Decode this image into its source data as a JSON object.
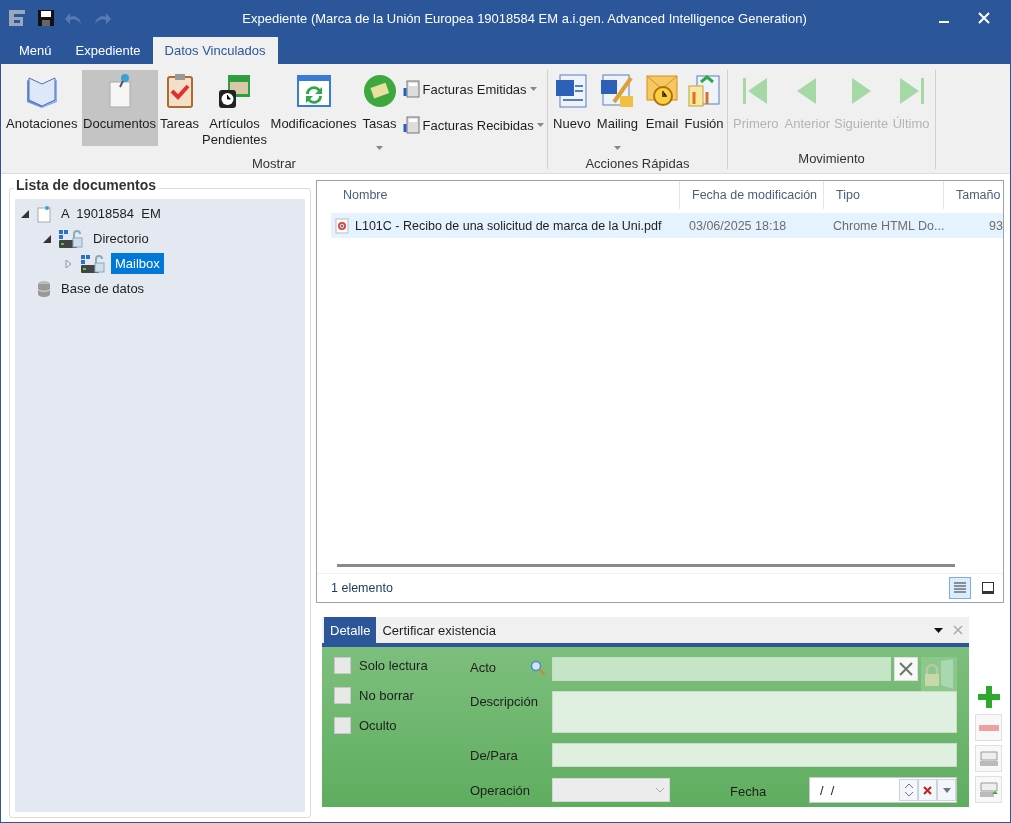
{
  "title_bar": {
    "title": "Expediente (Marca de la Unión Europea 19018584 EM a.i.gen. Advanced Intelligence Generation)"
  },
  "ribbon_tabs": [
    {
      "label": "Menú",
      "selected": false
    },
    {
      "label": "Expediente",
      "selected": false
    },
    {
      "label": "Datos Vinculados",
      "selected": true
    }
  ],
  "ribbon_groups": [
    {
      "label": "Mostrar",
      "items": [
        {
          "label": "Anotaciones",
          "kind": "large",
          "selected": false,
          "disabled": false,
          "dropdown": false
        },
        {
          "label": "Documentos",
          "kind": "large",
          "selected": true,
          "disabled": false,
          "dropdown": false
        },
        {
          "label": "Tareas",
          "kind": "large",
          "selected": false,
          "disabled": false,
          "dropdown": false
        },
        {
          "label": "Artículos Pendientes",
          "kind": "large",
          "selected": false,
          "disabled": false,
          "dropdown": false
        },
        {
          "label": "Modificaciones",
          "kind": "large",
          "selected": false,
          "disabled": false,
          "dropdown": false
        },
        {
          "label": "Tasas",
          "kind": "large",
          "selected": false,
          "disabled": false,
          "dropdown": true
        },
        {
          "label": "Facturas Emitidas",
          "kind": "small",
          "selected": false,
          "disabled": false,
          "dropdown": true
        },
        {
          "label": "Facturas Recibidas",
          "kind": "small",
          "selected": false,
          "disabled": false,
          "dropdown": true
        }
      ]
    },
    {
      "label": "Acciones Rápidas",
      "items": [
        {
          "label": "Nuevo",
          "kind": "large",
          "selected": false,
          "disabled": false,
          "dropdown": false
        },
        {
          "label": "Mailing",
          "kind": "large",
          "selected": false,
          "disabled": false,
          "dropdown": true
        },
        {
          "label": "Email",
          "kind": "large",
          "selected": false,
          "disabled": false,
          "dropdown": false
        },
        {
          "label": "Fusión",
          "kind": "large",
          "selected": false,
          "disabled": false,
          "dropdown": false
        }
      ]
    },
    {
      "label": "Movimiento",
      "items": [
        {
          "label": "Primero",
          "kind": "large",
          "selected": false,
          "disabled": true,
          "dropdown": false
        },
        {
          "label": "Anterior",
          "kind": "large",
          "selected": false,
          "disabled": true,
          "dropdown": false
        },
        {
          "label": "Siguiente",
          "kind": "large",
          "selected": false,
          "disabled": true,
          "dropdown": false
        },
        {
          "label": "Último",
          "kind": "large",
          "selected": false,
          "disabled": true,
          "dropdown": false
        }
      ]
    }
  ],
  "tree": {
    "title": "Lista de documentos",
    "items": [
      {
        "label": "A  19018584  EM",
        "expanded": true,
        "selected": false,
        "children": [
          {
            "label": "Directorio",
            "expanded": true,
            "selected": false,
            "children": [
              {
                "label": "Mailbox",
                "expanded": false,
                "selected": true
              }
            ]
          }
        ]
      },
      {
        "label": "Base de datos",
        "selected": false
      }
    ]
  },
  "file_list": {
    "columns": [
      "Nombre",
      "Fecha de modificación",
      "Tipo",
      "Tamaño"
    ],
    "rows": [
      {
        "selected": true,
        "cells": [
          "L101C - Recibo de una solicitud de marca de la Uni.pdf",
          "03/06/2025 18:18",
          "Chrome HTML Do...",
          "93"
        ]
      }
    ],
    "status": "1 elemento",
    "views": [
      {
        "kind": "details",
        "selected": true
      },
      {
        "kind": "preview",
        "selected": false
      }
    ]
  },
  "detail": {
    "tabs": [
      {
        "label": "Detalle",
        "selected": true
      },
      {
        "label": "Certificar existencia",
        "selected": false
      }
    ],
    "checkboxes": [
      {
        "label": "Solo lectura",
        "checked": false
      },
      {
        "label": "No borrar",
        "checked": false
      },
      {
        "label": "Oculto",
        "checked": false
      }
    ],
    "fields": {
      "acto": "Acto",
      "descripcion": "Descripción",
      "de_para": "De/Para",
      "operacion": "Operación",
      "fecha": "Fecha",
      "fecha_value": "/  /"
    }
  }
}
